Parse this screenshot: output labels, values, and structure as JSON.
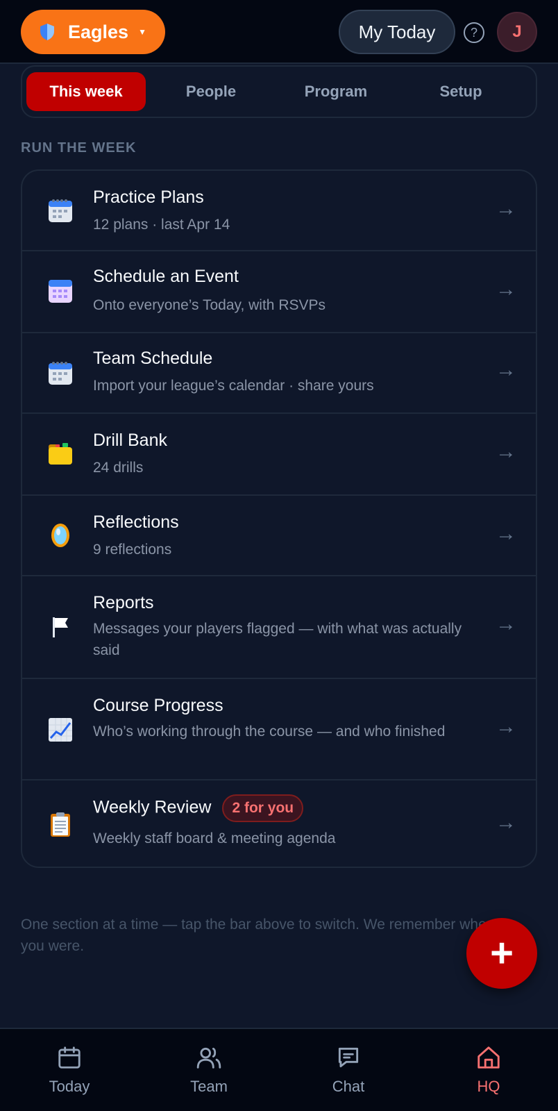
{
  "header": {
    "team_name": "Eagles",
    "today_label": "My Today",
    "help_label": "?",
    "avatar_initial": "J"
  },
  "tabs": [
    {
      "label": "This week",
      "active": true
    },
    {
      "label": "People",
      "active": false
    },
    {
      "label": "Program",
      "active": false
    },
    {
      "label": "Setup",
      "active": false
    }
  ],
  "section": {
    "label": "RUN THE WEEK",
    "items": [
      {
        "title": "Practice Plans",
        "subtitle": "12 plans · last Apr 14",
        "icon": "calendar-spiral-icon"
      },
      {
        "title": "Schedule an Event",
        "subtitle": "Onto everyone’s Today, with RSVPs",
        "icon": "calendar-icon"
      },
      {
        "title": "Team Schedule",
        "subtitle": "Import your league’s calendar · share yours",
        "icon": "calendar-spiral-icon"
      },
      {
        "title": "Drill Bank",
        "subtitle": "24 drills",
        "icon": "folder-icon"
      },
      {
        "title": "Reflections",
        "subtitle": "9 reflections",
        "icon": "mirror-icon"
      },
      {
        "title": "Reports",
        "subtitle": "Messages your players flagged — with what was actually said",
        "icon": "flag-icon"
      },
      {
        "title": "Course Progress",
        "subtitle": "Who’s working through the course — and who finished",
        "icon": "chart-up-icon"
      },
      {
        "title": "Weekly Review",
        "badge": "2 for you",
        "subtitle": "Weekly staff board & meeting agenda",
        "icon": "clipboard-icon"
      }
    ],
    "arrow": "→"
  },
  "hint": "One section at a time — tap the bar above to switch. We remember where you were.",
  "fab_label": "+",
  "bottom_nav": [
    {
      "label": "Today",
      "icon": "calendar-icon",
      "active": false
    },
    {
      "label": "Team",
      "icon": "users-icon",
      "active": false
    },
    {
      "label": "Chat",
      "icon": "chat-icon",
      "active": false
    },
    {
      "label": "HQ",
      "icon": "home-icon",
      "active": true
    }
  ],
  "colors": {
    "brand_orange": "#f97316",
    "accent_red": "#c00000",
    "background": "#0f172a"
  }
}
